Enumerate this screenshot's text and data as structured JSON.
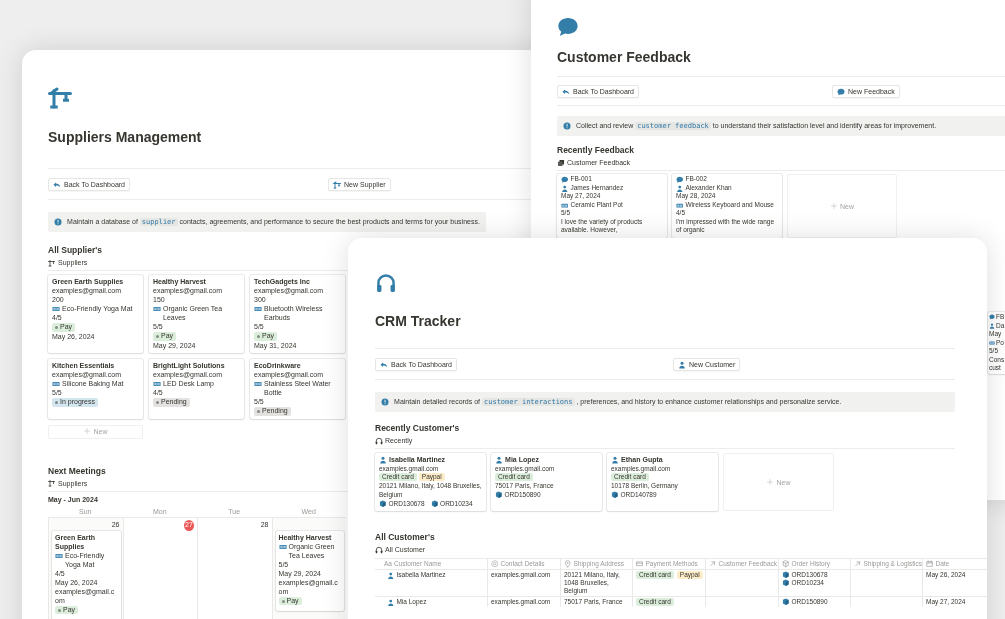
{
  "suppliers_window": {
    "title": "Suppliers Management",
    "back_button": "Back To Dashboard",
    "new_button": "New Supplier",
    "callout": {
      "before": "Maintain a database of ",
      "code": "supplier",
      "after": " contacts, agreements, and performance to secure the best products and terms for your business."
    },
    "suppliers_section": {
      "heading": "All Supplier's",
      "view_tab": "Suppliers",
      "new_card": "New",
      "cards": [
        {
          "name": "Green Earth Supplies",
          "email": "examples@gmail.com",
          "quantity": "200",
          "product": "Eco-Friendly Yoga Mat",
          "rating": "4/5",
          "status": {
            "label": "Pay",
            "color": "#dbeddb"
          },
          "date": "May 26, 2024"
        },
        {
          "name": "Healthy Harvest",
          "email": "examples@gmail.com",
          "quantity": "150",
          "product": "Organic Green Tea Leaves",
          "rating": "5/5",
          "status": {
            "label": "Pay",
            "color": "#dbeddb"
          },
          "date": "May 29, 2024"
        },
        {
          "name": "TechGadgets Inc",
          "email": "examples@gmail.com",
          "quantity": "300",
          "product": "Bluetooth Wireless Earbuds",
          "rating": "5/5",
          "status": {
            "label": "Pay",
            "color": "#dbeddb"
          },
          "date": "May 31, 2024"
        },
        {
          "name": "Kitchen Essentials",
          "email": "examples@gmail.com",
          "product": "Silicone Baking Mat",
          "rating": "5/5",
          "status": {
            "label": "In progress",
            "color": "#d3e5ef"
          }
        },
        {
          "name": "BrightLight Solutions",
          "email": "examples@gmail.com",
          "product": "LED Desk Lamp",
          "rating": "4/5",
          "status": {
            "label": "Pending",
            "color": "#e3e2e0"
          }
        },
        {
          "name": "EcoDrinkware",
          "email": "examples@gmail.com",
          "product": "Stainless Steel Water Bottle",
          "rating": "5/5",
          "status": {
            "label": "Pending",
            "color": "#e3e2e0"
          }
        }
      ]
    },
    "meetings_section": {
      "heading": "Next Meetings",
      "view_tab": "Suppliers",
      "range": "May - Jun 2024",
      "days": [
        {
          "label": "Sun",
          "date": "26",
          "today": false,
          "events": [
            {
              "title": "Green Earth Supplies",
              "product": "Eco-Friendly Yoga Mat",
              "rating": "4/5",
              "date": "May 26, 2024",
              "email": "examples@gmail.com",
              "status": {
                "label": "Pay",
                "color": "#dbeddb"
              }
            }
          ]
        },
        {
          "label": "Mon",
          "date": "27",
          "today": true
        },
        {
          "label": "Tue",
          "date": "28",
          "today": false
        },
        {
          "label": "Wed",
          "events": [
            {
              "title": "Healthy Harvest",
              "product": "Organic Green Tea Leaves",
              "rating": "5/5",
              "date": "May 29, 2024",
              "email": "examples@gmail.com",
              "status": {
                "label": "Pay",
                "color": "#dbeddb"
              }
            }
          ]
        }
      ]
    }
  },
  "feedback_window": {
    "title": "Customer Feedback",
    "back_button": "Back To Dashboard",
    "new_button": "New Feedback",
    "callout": {
      "before": "Collect and review ",
      "code": "customer feedback",
      "after": " to understand their satisfaction level and identify areas for improvement."
    },
    "heading": "Recently Feedback",
    "view_tab": "Customer Feedback",
    "new_card": "New",
    "cards": [
      {
        "id": "FB-001",
        "customer": "James Hernandez",
        "date": "May 27, 2024",
        "product": "Ceramic Plant Pot",
        "rating": "5/5",
        "comment": "I love the variety of products available. However,"
      },
      {
        "id": "FB-002",
        "customer": "Alexander Khan",
        "date": "May 28, 2024",
        "product": "Wireless Keyboard and Mouse",
        "rating": "4/5",
        "comment": "I'm impressed with the wide range of organic"
      }
    ],
    "edge_card": {
      "id": "FB",
      "customer": "Da",
      "date": "May",
      "product": "Po",
      "rating": "5/5",
      "comment": [
        "Cons",
        "cust"
      ]
    }
  },
  "crm_window": {
    "title": "CRM Tracker",
    "back_button": "Back To Dashboard",
    "new_button": "New Customer",
    "callout": {
      "before": "Maintain detailed records of ",
      "code": "customer interactions",
      "after": " , preferences, and history to enhance customer relationships and personalize service."
    },
    "recent_heading": "Recently Customer's",
    "recent_tab": "Recently",
    "new_card": "New",
    "cards": [
      {
        "name": "Isabella Martinez",
        "email": "examples.gmail.com",
        "payments": [
          {
            "label": "Credit card",
            "color": "#dbeddb"
          },
          {
            "label": "Paypal",
            "color": "#fdecc8"
          }
        ],
        "address": "20121 Milano, Italy, 1048 Bruxelles, Belgium",
        "orders": [
          "ORD130678",
          "ORD10234"
        ]
      },
      {
        "name": "Mia Lopez",
        "email": "examples.gmail.com",
        "payments": [
          {
            "label": "Credit card",
            "color": "#dbeddb"
          }
        ],
        "address": "75017 Paris, France",
        "orders": [
          "ORD150890"
        ]
      },
      {
        "name": "Ethan Gupta",
        "email": "examples.gmail.com",
        "payments": [
          {
            "label": "Credit card",
            "color": "#dbeddb"
          }
        ],
        "address": "10178 Berlin, Germany",
        "orders": [
          "ORD140789"
        ]
      }
    ],
    "table_heading": "All Customer's",
    "table_tab": "All Customer",
    "columns": [
      {
        "label": "Customer Name",
        "kind": "title",
        "glyph": "Aa"
      },
      {
        "label": "Contact Details",
        "kind": "email"
      },
      {
        "label": "Shipping Address",
        "kind": "place"
      },
      {
        "label": "Payment Methods",
        "kind": "select"
      },
      {
        "label": "Customer Feedback",
        "kind": "relation"
      },
      {
        "label": "Order History",
        "kind": "orders"
      },
      {
        "label": "Shipping & Logistics",
        "kind": "relation"
      },
      {
        "label": "Date",
        "kind": "date"
      }
    ],
    "rows": [
      {
        "name": "Isabella Martinez",
        "email": "examples.gmail.com",
        "address": "20121 Milano, Italy, 1048 Bruxelles, Belgium",
        "payments": [
          {
            "label": "Credit card",
            "color": "#dbeddb"
          },
          {
            "label": "Paypal",
            "color": "#fdecc8"
          }
        ],
        "orders": [
          "ORD130678",
          "ORD10234"
        ],
        "date": "May 26, 2024"
      },
      {
        "name": "Mia Lopez",
        "email": "examples.gmail.com",
        "address": "75017 Paris, France",
        "payments": [
          {
            "label": "Credit card",
            "color": "#dbeddb"
          }
        ],
        "orders": [
          "ORD150890"
        ],
        "date": "May 27, 2024"
      }
    ]
  }
}
